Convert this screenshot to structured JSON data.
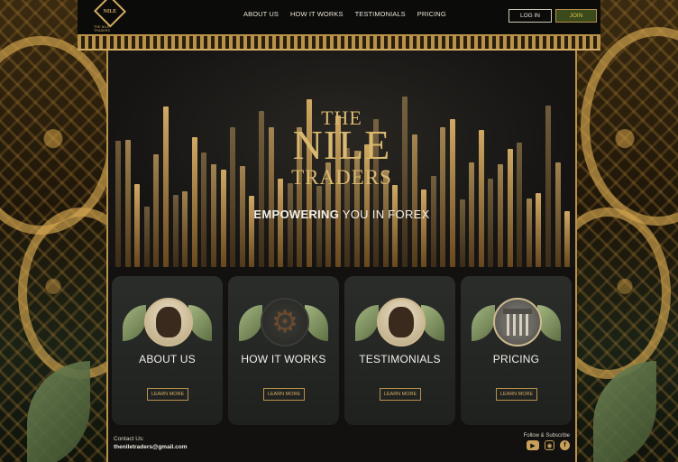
{
  "header": {
    "logo_text": "NILE",
    "logo_subtext": "THE NILE TRADERS",
    "nav": [
      "ABOUT US",
      "HOW IT WORKS",
      "TESTIMONIALS",
      "PRICING"
    ],
    "login_label": "LOG IN",
    "join_label": "JOIN"
  },
  "hero": {
    "title_line1": "THE",
    "title_line2": "NILE",
    "title_line3": "TRADERS",
    "tagline_bold": "EMPOWERING",
    "tagline_rest": " YOU IN FOREX"
  },
  "cards": [
    {
      "title": "ABOUT US",
      "button": "LEARN MORE",
      "icon": "portrait-icon"
    },
    {
      "title": "HOW IT WORKS",
      "button": "LEARN MORE",
      "icon": "gear-icon"
    },
    {
      "title": "TESTIMONIALS",
      "button": "LEARN MORE",
      "icon": "portrait-icon"
    },
    {
      "title": "PRICING",
      "button": "LEARN MORE",
      "icon": "temple-icon"
    }
  ],
  "footer": {
    "contact_label": "Contact Us:",
    "email": "theniletraders@gmail.com",
    "follow_label": "Follow & Subscribe",
    "social": [
      "youtube-icon",
      "instagram-icon",
      "facebook-icon"
    ]
  },
  "colors": {
    "gold": "#d2ab63",
    "background": "#121110",
    "join": "#3b4a1a"
  }
}
